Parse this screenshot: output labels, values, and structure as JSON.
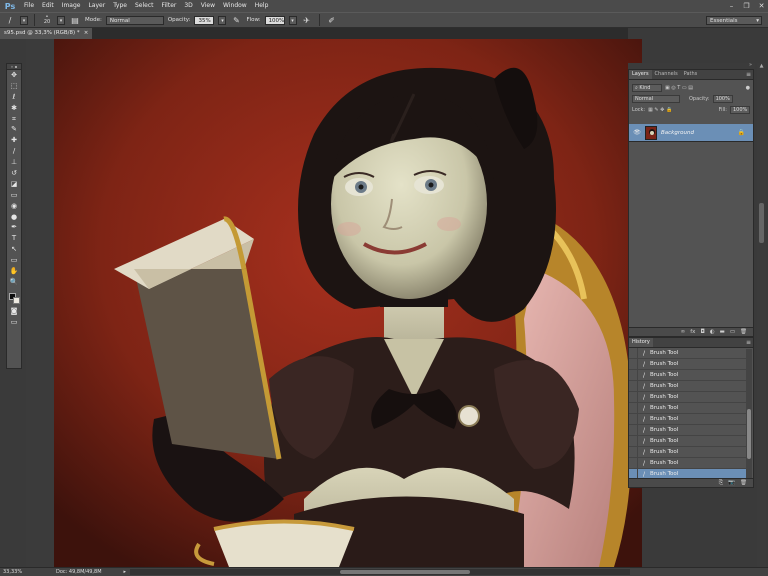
{
  "app": {
    "logo": "Ps"
  },
  "menu": [
    "File",
    "Edit",
    "Image",
    "Layer",
    "Type",
    "Select",
    "Filter",
    "3D",
    "View",
    "Window",
    "Help"
  ],
  "window_controls": {
    "minimize": "–",
    "restore": "❐",
    "close": "✕"
  },
  "options": {
    "brush_size": "20",
    "mode_label": "Mode:",
    "mode_value": "Normal",
    "opacity_label": "Opacity:",
    "opacity_value": "35%",
    "flow_label": "Flow:",
    "flow_value": "100%",
    "workspace": "Essentials"
  },
  "document": {
    "tab_title": "s95.psd @ 33,3% (RGB/8) *",
    "close": "×"
  },
  "tools": [
    "move-icon",
    "marquee-icon",
    "lasso-icon",
    "quick-select-icon",
    "crop-icon",
    "eyedropper-icon",
    "spot-heal-icon",
    "brush-icon",
    "clone-stamp-icon",
    "history-brush-icon",
    "eraser-icon",
    "gradient-icon",
    "blur-icon",
    "dodge-icon",
    "pen-icon",
    "type-icon",
    "path-select-icon",
    "shape-icon",
    "hand-icon",
    "zoom-icon"
  ],
  "tool_glyphs": [
    "✥",
    "⬚",
    "ℓ",
    "✱",
    "⌗",
    "✎",
    "✚",
    "/",
    "⊥",
    "↺",
    "◪",
    "▭",
    "◉",
    "●",
    "✒",
    "T",
    "↖",
    "▭",
    "✋",
    "🔍"
  ],
  "colors": {
    "foreground": "#0d0d0d",
    "background": "#ece8df",
    "accent": "#6b8fb6"
  },
  "layers_panel": {
    "tabs": [
      "Layers",
      "Channels",
      "Paths"
    ],
    "filter": "Kind",
    "blend_mode": "Normal",
    "opacity_label": "Opacity:",
    "opacity_value": "100%",
    "lock_label": "Lock:",
    "fill_label": "Fill:",
    "fill_value": "100%",
    "layers": [
      {
        "name": "Background",
        "visible": true,
        "locked": true
      }
    ]
  },
  "history_panel": {
    "title": "History",
    "items": [
      "Brush Tool",
      "Brush Tool",
      "Brush Tool",
      "Brush Tool",
      "Brush Tool",
      "Brush Tool",
      "Brush Tool",
      "Brush Tool",
      "Brush Tool",
      "Brush Tool",
      "Brush Tool",
      "Brush Tool"
    ],
    "selected_index": 11
  },
  "status": {
    "zoom": "33,33%",
    "doc": "Doc: 49,8M/49,8M"
  }
}
